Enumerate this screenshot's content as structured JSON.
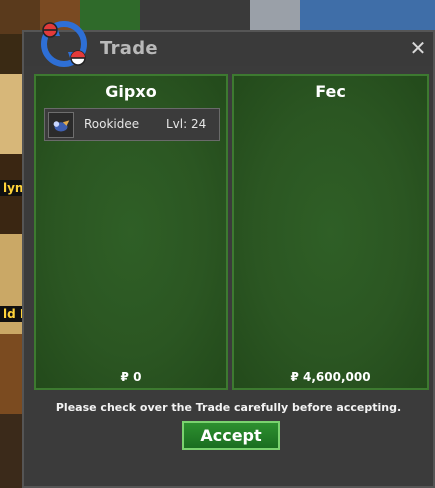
{
  "window": {
    "title": "Trade",
    "close_label": "✕"
  },
  "background": {
    "left_labels": [
      "lyn",
      "ld M"
    ]
  },
  "left_panel": {
    "name": "Gipxo",
    "items": [
      {
        "pokemon": "Rookidee",
        "level": "Lvl: 24"
      }
    ],
    "money": "₽ 0"
  },
  "right_panel": {
    "name": "Fec",
    "money": "₽ 4,600,000"
  },
  "notice": "Please check over the Trade carefully before accepting.",
  "accept_label": "Accept",
  "colors": {
    "panel_green": "#2b5622",
    "panel_border": "#3d7a30",
    "button_green": "#1f7a25",
    "window_bg": "#3b3b3b"
  },
  "icons": [
    "trade-logo-icon",
    "close-icon",
    "rookidee-sprite-icon"
  ]
}
